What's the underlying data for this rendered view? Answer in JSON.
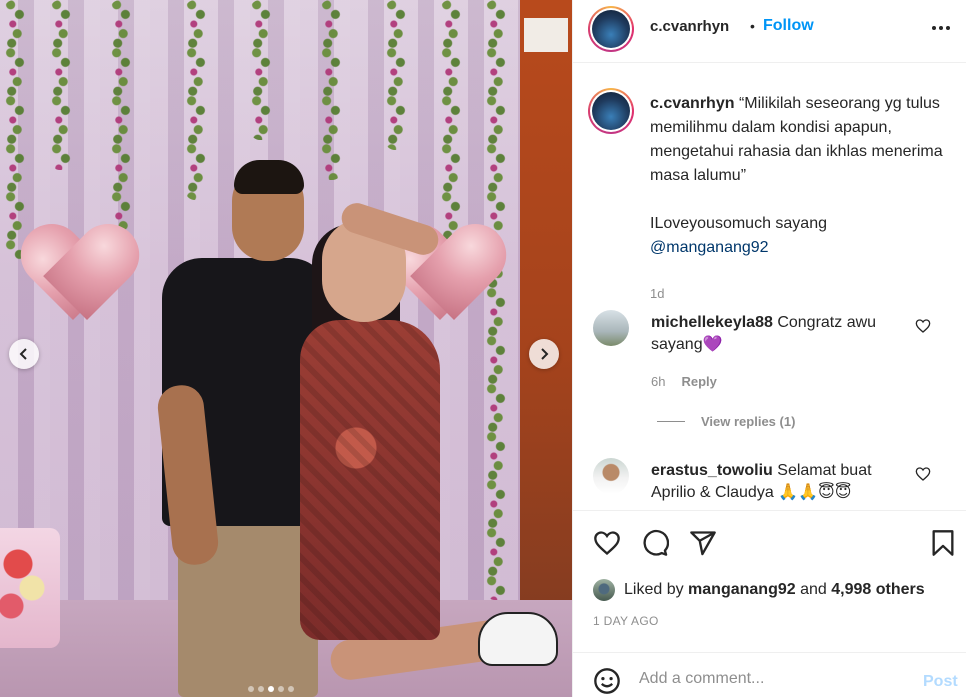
{
  "post": {
    "username": "c.cvanrhyn",
    "separator": "•",
    "follow_label": "Follow",
    "caption": {
      "username": "c.cvanrhyn",
      "lines": [
        "“Milikilah seseorang yg tulus",
        "memilihmu dalam kondisi apapun,",
        "mengetahui rahasia dan ikhlas menerima",
        "masa lalumu”"
      ],
      "line2": "ILoveyousomuch sayang",
      "mention": "@manganang92",
      "time": "1d"
    },
    "comments": [
      {
        "username": "michellekeyla88",
        "text_line1": "Congratz awu",
        "text_line2": "sayang💜",
        "time": "6h",
        "reply_label": "Reply",
        "view_replies_label": "View replies (1)"
      },
      {
        "username": "erastus_towoliu",
        "text_line1": "Selamat buat",
        "text_line2": "Aprilio & Claudya 🙏🙏😇😇"
      }
    ],
    "likes": {
      "prefix": "Liked by",
      "user": "manganang92",
      "and": "and",
      "others": "4,998 others"
    },
    "date": "1 DAY AGO",
    "add_comment": {
      "placeholder": "Add a comment...",
      "post_label": "Post"
    },
    "carousel": {
      "slide_count": 5,
      "active_index": 2
    }
  },
  "icons": {
    "like": "heart-icon",
    "comment": "comment-icon",
    "share": "paper-plane-icon",
    "save": "bookmark-icon",
    "more": "more-options-icon",
    "emoji": "smiley-icon",
    "prev": "chevron-left-icon",
    "next": "chevron-right-icon"
  },
  "colors": {
    "follow": "#0095f6",
    "post_disabled": "#b3dbff",
    "muted": "#8e8e8e",
    "mention": "#00376b"
  }
}
